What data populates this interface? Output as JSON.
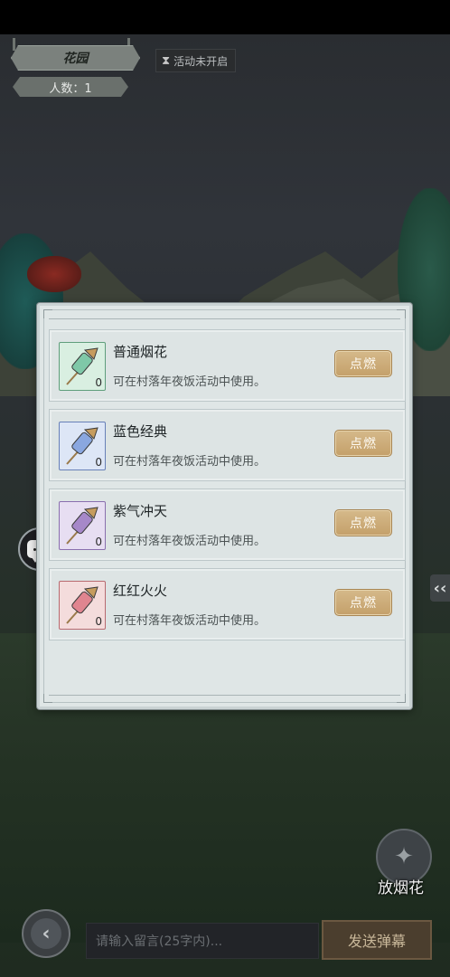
{
  "location": {
    "name": "花园",
    "count_label": "人数：1"
  },
  "activity_status": "活动未开启",
  "fireworks": [
    {
      "name": "普通烟花",
      "desc": "可在村落年夜饭活动中使用。",
      "qty": "0",
      "button": "点燃",
      "color": "#7fc8a8",
      "frame": "#5f9e7c",
      "bg": "#d9efe1"
    },
    {
      "name": "蓝色经典",
      "desc": "可在村落年夜饭活动中使用。",
      "qty": "0",
      "button": "点燃",
      "color": "#8aa7df",
      "frame": "#6780b8",
      "bg": "#dde6f6"
    },
    {
      "name": "紫气冲天",
      "desc": "可在村落年夜饭活动中使用。",
      "qty": "0",
      "button": "点燃",
      "color": "#a688c9",
      "frame": "#8a6fae",
      "bg": "#e7def2"
    },
    {
      "name": "红红火火",
      "desc": "可在村落年夜饭活动中使用。",
      "qty": "0",
      "button": "点燃",
      "color": "#e08590",
      "frame": "#b86a70",
      "bg": "#f4dcdc"
    }
  ],
  "message_input": {
    "placeholder": "请输入留言(25字内)..."
  },
  "send_button": "发送弹幕",
  "fire_button": "放烟花"
}
